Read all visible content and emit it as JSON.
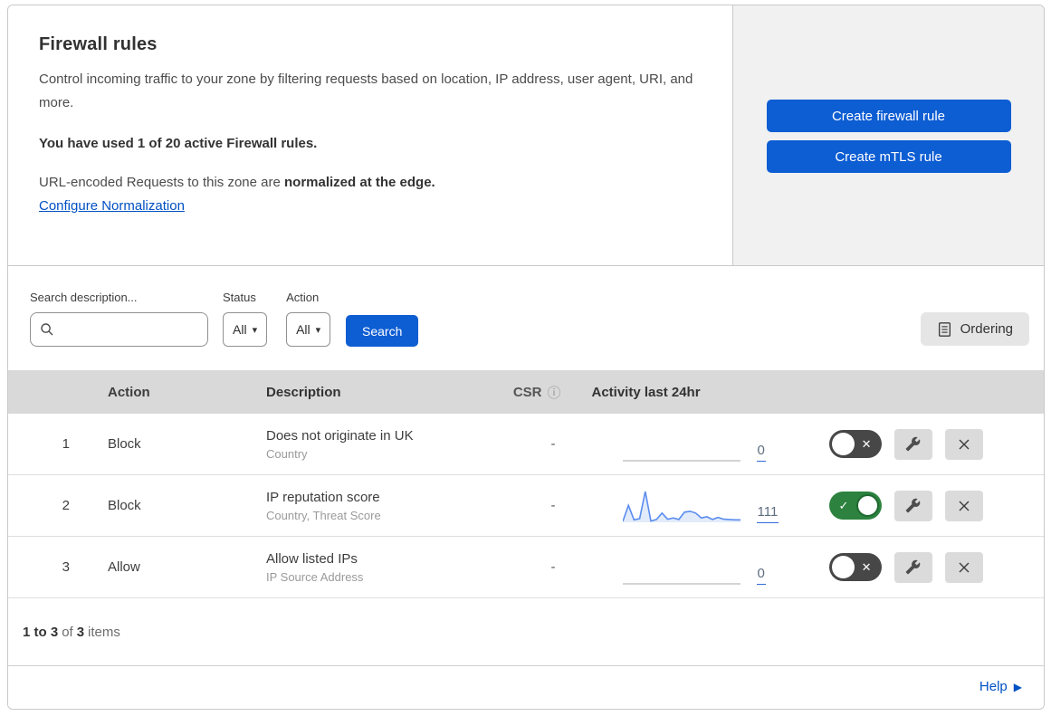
{
  "panel": {
    "header": {
      "title": "Firewall rules",
      "description": "Control incoming traffic to your zone by filtering requests based on location, IP address, user agent, URI, and more.",
      "usage_notice": "You have used 1 of 20 active Firewall rules.",
      "normalization_prefix": "URL-encoded Requests to this zone are ",
      "normalization_bold": "normalized at the edge.",
      "normalization_link": "Configure Normalization",
      "create_firewall_rule_button": "Create firewall rule",
      "create_mtls_rule_button": "Create mTLS rule"
    },
    "filters": {
      "search_label": "Search description...",
      "search_value": "",
      "status_label": "Status",
      "status_value": "All",
      "action_label": "Action",
      "action_value": "All",
      "search_button": "Search",
      "ordering_button": "Ordering"
    },
    "table": {
      "headers": {
        "action": "Action",
        "description": "Description",
        "csr": "CSR",
        "activity": "Activity last 24hr"
      },
      "rows": [
        {
          "number": "1",
          "action": "Block",
          "description": "Does not originate in UK",
          "match_fields": "Country",
          "csr": "-",
          "activity_count": "0",
          "enabled": false,
          "has_activity_chart": false
        },
        {
          "number": "2",
          "action": "Block",
          "description": "IP reputation score",
          "match_fields": "Country, Threat Score",
          "csr": "-",
          "activity_count": "111",
          "enabled": true,
          "has_activity_chart": true
        },
        {
          "number": "3",
          "action": "Allow",
          "description": "Allow listed IPs",
          "match_fields": "IP Source Address",
          "csr": "-",
          "activity_count": "0",
          "enabled": false,
          "has_activity_chart": false
        }
      ]
    },
    "footer": {
      "range": "1 to 3",
      "of_word": "of",
      "total": "3",
      "items_word": "items",
      "help_link": "Help"
    }
  },
  "icons": {
    "caret_down_icon": "▾",
    "info_icon": "ⓘ",
    "toggle_check_icon": "✓",
    "toggle_x_icon": "✕",
    "help_arrow_icon": "▶"
  },
  "colors": {
    "accent_blue": "#0d5dd3",
    "link_blue": "#0051c3",
    "toggle_on_green": "#2c823e",
    "toggle_off_gray": "#474747",
    "spark_line_blue": "#5b8def",
    "spark_fill_blue": "#e1ebfa",
    "flat_line_gray": "#c6c6c6",
    "table_header_gray": "#d9d9d9"
  },
  "chart_data": {
    "type": "line",
    "title": "Activity last 24hr sparkline — rule 2 (IP reputation score), total 111",
    "values": [
      3,
      55,
      8,
      12,
      100,
      4,
      9,
      30,
      10,
      14,
      9,
      33,
      36,
      30,
      14,
      18,
      9,
      16,
      10,
      9,
      8,
      8
    ],
    "ylim": [
      0,
      100
    ],
    "xlabel": "",
    "ylabel": "",
    "legend": "none",
    "note": "Unlabeled sparkline; values are relative heights (0–100) estimated from pixels. Rules 1 and 3 show flat zero-activity lines with count 0."
  }
}
